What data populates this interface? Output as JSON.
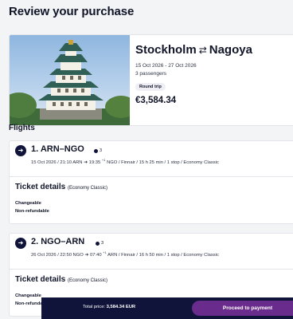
{
  "page": {
    "title": "Review your purchase"
  },
  "summary": {
    "origin": "Stockholm",
    "route_arrow": "⇄",
    "destination": "Nagoya",
    "dates": "15 Oct 2026 - 27 Oct 2026",
    "passengers": "3 passengers",
    "trip_type": "Round trip",
    "price": "€3,584.34",
    "image_icon": "nagoya-castle-image"
  },
  "flights_heading": "Flights",
  "flights": [
    {
      "title": "1. ARN–NGO",
      "seats": "3",
      "date_time": "15 Oct 2026 / 21:10 ARN",
      "arrival": "19:35",
      "day_offset": "+1",
      "rest": "NGO / Finnair / 15 h 25 min / 1 stop / Economy Classic",
      "ticket_title": "Ticket details",
      "ticket_class": "(Economy Classic)",
      "conditions": [
        "Changeable",
        "Non-refundable"
      ]
    },
    {
      "title": "2. NGO–ARN",
      "seats": "3",
      "date_time": "26 Oct 2026 / 22:50 NGO",
      "arrival": "07:40",
      "day_offset": "+1",
      "rest": "ARN / Finnair / 16 h 50 min / 1 stop / Economy Classic",
      "ticket_title": "Ticket details",
      "ticket_class": "(Economy Classic)",
      "conditions": [
        "Changeable",
        "Non-refundable"
      ]
    }
  ],
  "footer": {
    "total_label": "Total price:",
    "total_value": "3,584.34 EUR",
    "pay_label": "Proceed to payment"
  },
  "colors": {
    "navy": "#10143a",
    "purple": "#6a2c8c"
  }
}
